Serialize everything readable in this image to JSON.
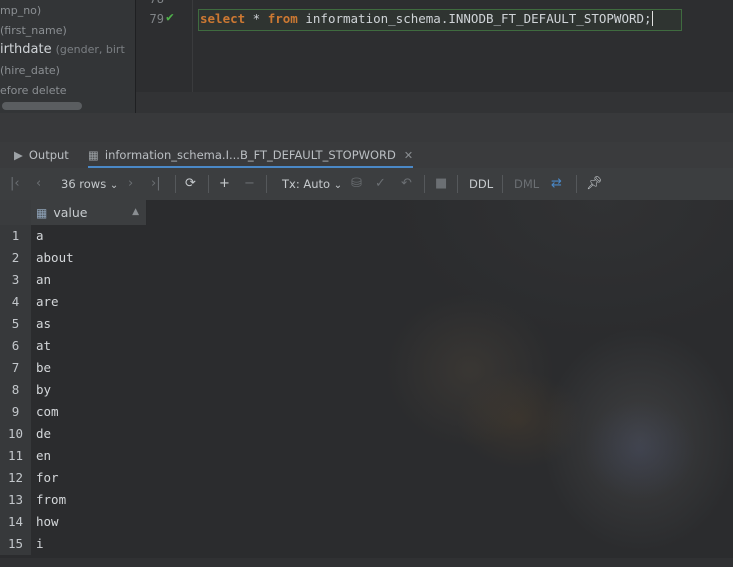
{
  "structure": {
    "items": [
      {
        "text": "mp_no)",
        "sub": ""
      },
      {
        "text": "(first_name)",
        "sub": ""
      },
      {
        "text": "irthdate",
        "sub": "(gender, birt"
      },
      {
        "text": "(hire_date)",
        "sub": ""
      },
      {
        "text": "efore delete",
        "sub": ""
      }
    ]
  },
  "editor": {
    "prev_line_number": "78",
    "line_number": "79",
    "code": {
      "kw1": "select",
      "star": " * ",
      "kw2": "from",
      "rest": " information_schema.INNODB_FT_DEFAULT_STOPWORD;"
    }
  },
  "tabs": [
    {
      "label": "Output",
      "icon": "console-icon"
    },
    {
      "label": "information_schema.I...B_FT_DEFAULT_STOPWORD",
      "icon": "table-icon"
    }
  ],
  "toolbar": {
    "rows_label": "36 rows",
    "tx_label": "Tx: Auto",
    "ddl_label": "DDL",
    "dml_label": "DML"
  },
  "grid": {
    "column": "value",
    "rows": [
      {
        "n": "1",
        "v": "a"
      },
      {
        "n": "2",
        "v": "about"
      },
      {
        "n": "3",
        "v": "an"
      },
      {
        "n": "4",
        "v": "are"
      },
      {
        "n": "5",
        "v": "as"
      },
      {
        "n": "6",
        "v": "at"
      },
      {
        "n": "7",
        "v": "be"
      },
      {
        "n": "8",
        "v": "by"
      },
      {
        "n": "9",
        "v": "com"
      },
      {
        "n": "10",
        "v": "de"
      },
      {
        "n": "11",
        "v": "en"
      },
      {
        "n": "12",
        "v": "for"
      },
      {
        "n": "13",
        "v": "from"
      },
      {
        "n": "14",
        "v": "how"
      },
      {
        "n": "15",
        "v": "i"
      }
    ]
  },
  "colors": {
    "keyword": "#cc7832",
    "success": "#4fb04a",
    "accent": "#4a88c7"
  }
}
